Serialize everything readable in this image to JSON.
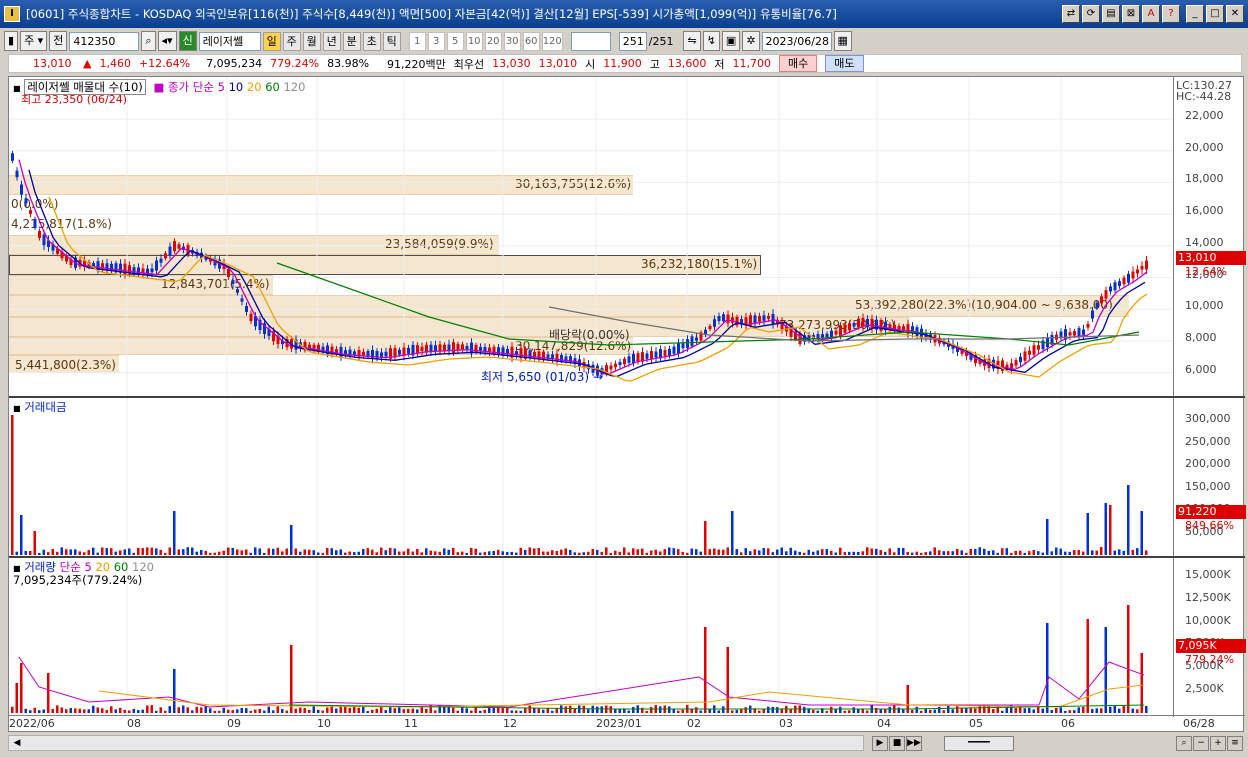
{
  "window": {
    "title": "[0601] 주식종합차트 - KOSDAQ 외국인보유[116(천)] 주식수[8,449(천)] 액면[500] 자본금[42(억)] 결산[12월] EPS[-539] 시가총액[1,099(억)] 유통비율[76.7]"
  },
  "toolbar": {
    "mode": "주",
    "prev": "전",
    "code": "412350",
    "indicator": "레이저쎌",
    "sin": "신",
    "periods": [
      "일",
      "주",
      "월",
      "년",
      "분",
      "초",
      "틱"
    ],
    "nums": [
      "1",
      "3",
      "5",
      "10",
      "20",
      "30",
      "60",
      "120"
    ],
    "count": "251",
    "count_total": "/251",
    "date": "2023/06/28"
  },
  "info": {
    "price": "13,010",
    "change": "1,460",
    "rate": "+12.64%",
    "volume": "7,095,234",
    "vol_ratio": "779.24%",
    "ratio2": "83.98%",
    "amount": "91,220백만",
    "best_label": "최우선",
    "ask": "13,030",
    "bid": "13,010",
    "open_label": "시",
    "open": "11,900",
    "high_label": "고",
    "high": "13,600",
    "low_label": "저",
    "low": "11,700",
    "buy": "매수",
    "sell": "매도"
  },
  "price_panel": {
    "legend": "레이저쎌 매물대 수(10)",
    "ma_label": "종가 단순",
    "ma_periods": [
      "5",
      "10",
      "20",
      "60",
      "120"
    ],
    "high_note": "최고 23,350 (06/24)",
    "lc": "LC:130.27",
    "hc": "HC:-44.28",
    "last_price": "13,010",
    "last_rate": "12.64%",
    "dividend": "배당락(0.00%)",
    "low_note": "최저 5,650 (01/03)",
    "yticks": [
      "22,000",
      "20,000",
      "18,000",
      "16,000",
      "14,000",
      "12,000",
      "10,000",
      "8,000",
      "6,000"
    ],
    "bands": [
      "30,163,755(12.6%)",
      "0(0.0%)",
      "4,215,817(1.8%)",
      "23,584,059(9.9%)",
      "36,232,180(15.1%)",
      "12,843,701(5.4%)",
      "53,392,280(22.3%)(10,904.00 ~ 9,638.00)",
      "30,147,829(12.6%)",
      "5,441,800(2.3%)",
      "73,273,993(30.6%)"
    ]
  },
  "amount_panel": {
    "title": "거래대금",
    "yticks": [
      "300,000",
      "250,000",
      "200,000",
      "150,000",
      "100,000",
      "50,000"
    ],
    "last": "91,220",
    "rate": "849.66%"
  },
  "volume_panel": {
    "title": "거래량",
    "ma_label": "단순",
    "ma_periods": [
      "5",
      "20",
      "60",
      "120"
    ],
    "sub": "7,095,234주(779.24%)",
    "yticks": [
      "15,000K",
      "12,500K",
      "10,000K",
      "7,500K",
      "5,000K",
      "2,500K"
    ],
    "last": "7,095K",
    "rate": "779.24%"
  },
  "xaxis": [
    "2022/06",
    "08",
    "09",
    "10",
    "11",
    "12",
    "2023/01",
    "02",
    "03",
    "04",
    "05",
    "06",
    "06/28"
  ],
  "colors": {
    "up": "#e00000",
    "down": "#0030d0",
    "ma5": "#c000c0",
    "ma10": "#0000a0",
    "ma20": "#f0a000",
    "ma60": "#008000",
    "ma120": "#606060"
  }
}
